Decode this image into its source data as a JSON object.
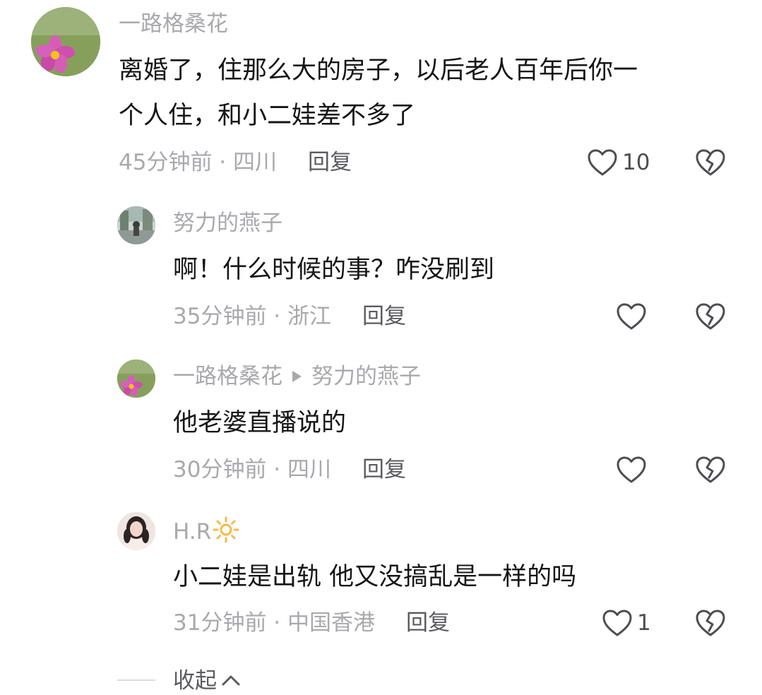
{
  "comments": [
    {
      "username": "一路格桑花",
      "text_line1": "离婚了，住那么大的房子，以后老人百年后你一",
      "text_line2": "个人住，和小二娃差不多了",
      "time": "45分钟前",
      "sep": " · ",
      "location": "四川",
      "reply": "回复",
      "likes": "10",
      "avatar": "pink-flower"
    },
    {
      "username": "努力的燕子",
      "text": "啊！什么时候的事？咋没刷到",
      "time": "35分钟前",
      "sep": " · ",
      "location": "浙江",
      "reply": "回复",
      "avatar": "outdoor-photo"
    },
    {
      "username": "一路格桑花",
      "reply_to": "努力的燕子",
      "text": "他老婆直播说的",
      "time": "30分钟前",
      "sep": " · ",
      "location": "四川",
      "reply": "回复",
      "avatar": "pink-flower"
    },
    {
      "username": "H.R",
      "username_emoji": "☀",
      "text": "小二娃是出轨 他又没搞乱是一样的吗",
      "time": "31分钟前",
      "sep": " · ",
      "location": "中国香港",
      "reply": "回复",
      "likes": "1",
      "avatar": "woman-portrait"
    }
  ],
  "collapse_label": "收起",
  "icons": {
    "like": "heart-outline-icon",
    "dislike": "broken-heart-icon",
    "collapse": "chevron-up-icon"
  },
  "colors": {
    "username": "#a9a9ad",
    "text": "#161616",
    "sun": "#f5b94a",
    "flower": "#d94fb0"
  }
}
